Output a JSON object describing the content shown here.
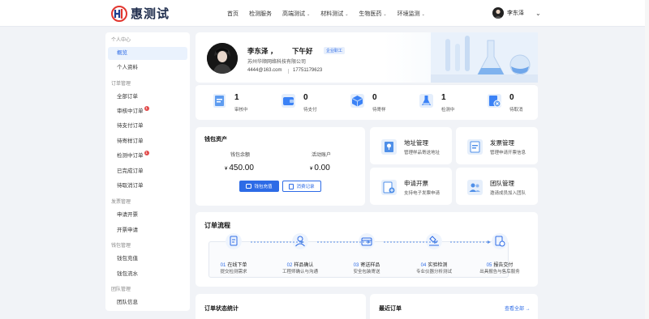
{
  "header": {
    "logo_text": "惠测试",
    "nav": [
      {
        "label": "首页",
        "dropdown": false
      },
      {
        "label": "检测服务",
        "dropdown": false
      },
      {
        "label": "高端测试",
        "dropdown": true
      },
      {
        "label": "材料测试",
        "dropdown": true
      },
      {
        "label": "生物医药",
        "dropdown": true
      },
      {
        "label": "环境监测",
        "dropdown": true
      }
    ],
    "user_name": "李东泽"
  },
  "sidebar": {
    "groups": [
      {
        "title": "个人中心",
        "items": [
          {
            "label": "概览",
            "active": true
          },
          {
            "label": "个人资料"
          }
        ]
      },
      {
        "title": "订单管理",
        "items": [
          {
            "label": "全部订单"
          },
          {
            "label": "审核中订单",
            "badge": "1"
          },
          {
            "label": "待支付订单"
          },
          {
            "label": "待寄样订单"
          },
          {
            "label": "检测中订单",
            "badge": "1"
          },
          {
            "label": "已完成订单"
          },
          {
            "label": "待取消订单"
          }
        ]
      },
      {
        "title": "发票管理",
        "items": [
          {
            "label": "申请开票"
          },
          {
            "label": "开票申请"
          }
        ]
      },
      {
        "title": "钱包管理",
        "items": [
          {
            "label": "钱包充值"
          },
          {
            "label": "钱包流水"
          }
        ]
      },
      {
        "title": "团队管理",
        "items": [
          {
            "label": "团队信息"
          }
        ]
      }
    ]
  },
  "profile": {
    "name": "李东泽",
    "comma": "，",
    "greeting": "下午好",
    "tag": "企业职工",
    "company": "苏州华顺网络科技有限公司",
    "email": "4444@163.com",
    "phone": "17751179623"
  },
  "stats": [
    {
      "value": "1",
      "label": "审核中",
      "icon": "clipboard-icon",
      "color": "#4a90e8"
    },
    {
      "value": "0",
      "label": "待支付",
      "icon": "wallet-icon",
      "color": "#3b82f6"
    },
    {
      "value": "0",
      "label": "待寄样",
      "icon": "box-icon",
      "color": "#3b82f6"
    },
    {
      "value": "1",
      "label": "检测中",
      "icon": "flask-icon",
      "color": "#3b82f6"
    },
    {
      "value": "0",
      "label": "待取消",
      "icon": "cancel-doc-icon",
      "color": "#3b82f6"
    }
  ],
  "wallet": {
    "title": "钱包资产",
    "balance_label": "钱包余额",
    "balance_currency": "¥",
    "balance_value": "450.00",
    "promo_label": "活动账户",
    "promo_currency": "¥",
    "promo_value": "0.00",
    "recharge_btn": "钱包充值",
    "records_btn": "消费记录"
  },
  "quick_cards": [
    {
      "title": "地址管理",
      "sub": "管理样品寄送地址",
      "icon": "location-icon"
    },
    {
      "title": "发票管理",
      "sub": "管理申请开票信息",
      "icon": "invoice-icon"
    },
    {
      "title": "申请开票",
      "sub": "支持电子发票申请",
      "icon": "apply-invoice-icon"
    },
    {
      "title": "团队管理",
      "sub": "邀请成员加入团队",
      "icon": "team-icon"
    }
  ],
  "flow": {
    "title": "订单流程",
    "steps": [
      {
        "no": "01",
        "title": "在线下单",
        "sub": "提交检测需求"
      },
      {
        "no": "02",
        "title": "样品确认",
        "sub": "工程师确认与沟通"
      },
      {
        "no": "03",
        "title": "寄送样品",
        "sub": "安全包装寄送"
      },
      {
        "no": "04",
        "title": "实验检测",
        "sub": "专业仪器分析测试"
      },
      {
        "no": "05",
        "title": "报告交付",
        "sub": "出具报告与售后服务"
      }
    ]
  },
  "bottom": {
    "order_stats_title": "订单状态统计",
    "recent_orders_title": "最近订单",
    "view_all": "查看全部 →"
  },
  "colors": {
    "primary": "#2d6be6",
    "badge": "#e24a4a"
  }
}
